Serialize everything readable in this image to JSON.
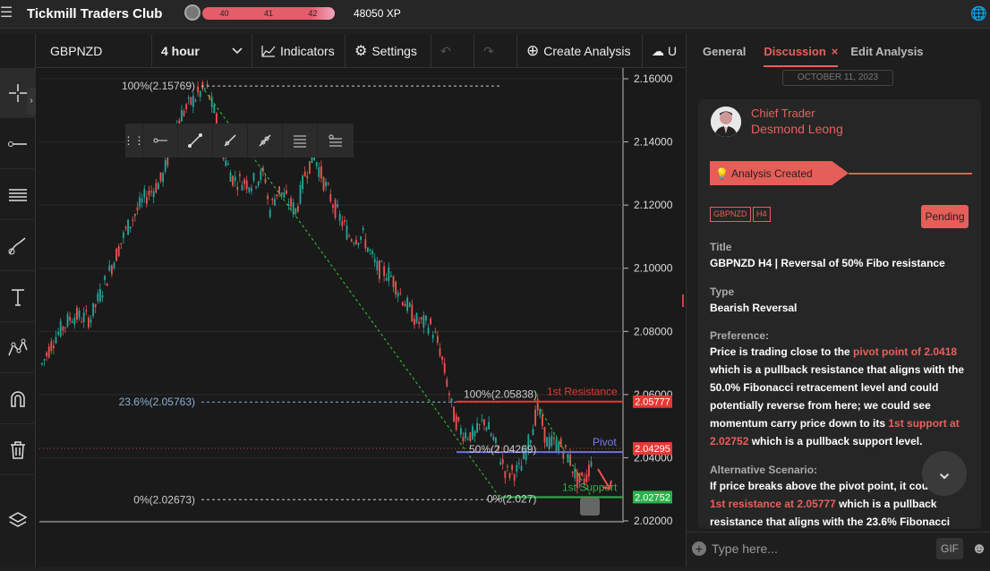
{
  "topbar": {
    "brand": "Tickmill Traders Club",
    "levels": [
      "40",
      "41",
      "42"
    ],
    "xp": "48050 XP"
  },
  "toolbar": {
    "symbol": "GBPNZD",
    "interval": "4 hour",
    "indicators": "Indicators",
    "settings": "Settings",
    "create": "Create Analysis",
    "u": "U"
  },
  "chart": {
    "price_labels": [
      "2.16000",
      "2.14000",
      "2.12000",
      "2.10000",
      "2.08000",
      "2.06000",
      "2.04000",
      "2.02000"
    ],
    "tags": [
      {
        "text": "2.05777",
        "color": "#e53935"
      },
      {
        "text": "2.04295",
        "color": "#e53935"
      },
      {
        "text": "2.02752",
        "color": "#2bb24c"
      }
    ],
    "fibo": {
      "top": "100%(2.15769)",
      "r236": "23.6%(2.05763)",
      "zero": "0%(2.02673)"
    },
    "fibo2": {
      "top": "100%(2.05838)",
      "mid": "50%(2.04269)",
      "zero": "0%(2.027)"
    },
    "labels": {
      "res": "1st Resistance",
      "pivot": "Pivot",
      "sup": "1st Support"
    },
    "colors": {
      "up": "#26a69a",
      "down": "#ef5350",
      "bg": "#1a1a1a"
    }
  },
  "panel": {
    "tabs": [
      "General",
      "Discussion",
      "Edit Analysis"
    ],
    "date": "OCTOBER 11, 2023",
    "role": "Chief Trader",
    "name": "Desmond Leong",
    "created": "Analysis Created",
    "tags": [
      "GBPNZD",
      "H4"
    ],
    "status": "Pending",
    "title_label": "Title",
    "title": "GBPNZD H4 | Reversal of 50% Fibo resistance",
    "type_label": "Type",
    "type": "Bearish Reversal",
    "pref_label": "Preference:",
    "pref_a": "Price is trading close to the ",
    "pref_b": "pivot point of 2.0418",
    "pref_c": " which is a pullback resistance that aligns with the 50.0% Fibonacci retracement level and could potentially reverse from here; we could see momentum carry price down to its ",
    "pref_d": "1st support at 2.02752",
    "pref_e": " which is a pullback support level.",
    "alt_label": "Alternative Scenario:",
    "alt_a": "If price breaks above the pivot point, it could r",
    "alt_b": "1st resistance at 2.05777",
    "alt_c": " which is a pullback resistance that aligns with the 23.6% Fibonacci",
    "chat_placeholder": "Type here...",
    "gif": "GIF"
  }
}
